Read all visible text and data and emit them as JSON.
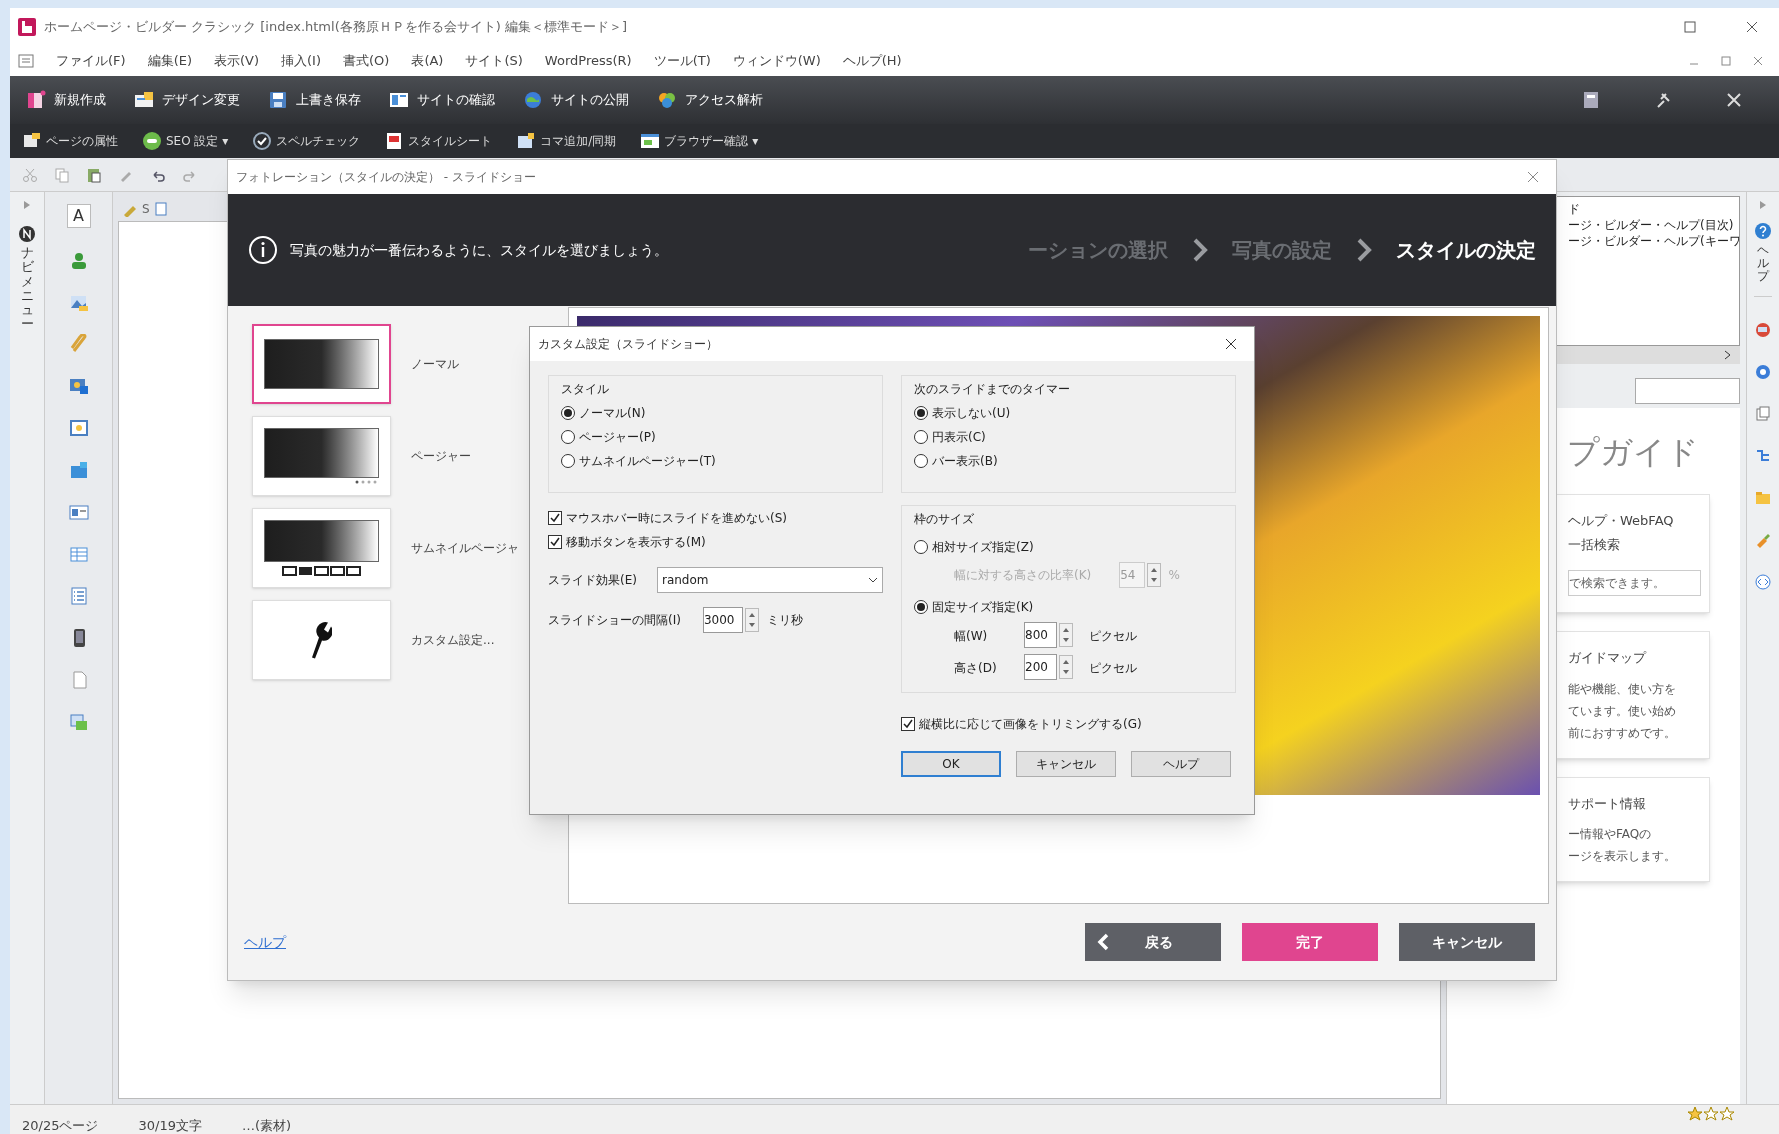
{
  "window": {
    "title": "ホームページ・ビルダー クラシック  [index.html(各務原ＨＰを作る会サイト)  編集＜標準モード＞]"
  },
  "menu": [
    "ファイル(F)",
    "編集(E)",
    "表示(V)",
    "挿入(I)",
    "書式(O)",
    "表(A)",
    "サイト(S)",
    "WordPress(R)",
    "ツール(T)",
    "ウィンドウ(W)",
    "ヘルプ(H)"
  ],
  "toolbar": [
    "新規作成",
    "デザイン変更",
    "上書き保存",
    "サイトの確認",
    "サイトの公開",
    "アクセス解析"
  ],
  "toolbar_2": [
    "ページの属性",
    "SEO 設定 ▾",
    "スペルチェック",
    "スタイルシート",
    "コマ追加/同期",
    "ブラウザー確認 ▾"
  ],
  "nav_tab": "ナビメニュー",
  "text_tool": "A",
  "editor_tab": "S",
  "help_tab": "ヘルプ",
  "right_panel": {
    "list_lines": [
      "ド",
      "ージ・ビルダー・ヘルプ(目次)",
      "ージ・ビルダー・ヘルプ(キーワ"
    ],
    "heading": "プガイド",
    "cards": [
      {
        "title_lines": [
          "ヘルプ・WebFAQ",
          "一括検索"
        ],
        "field": "で検索できます。"
      },
      {
        "title_lines": [
          "ガイドマップ"
        ],
        "lines": [
          "能や機能、使い方を",
          "ています。使い始め",
          "前におすすめです。"
        ]
      },
      {
        "title_lines": [
          "サポート情報"
        ],
        "lines": [
          "ー情報やFAQの",
          "ージを表示します。"
        ]
      }
    ]
  },
  "status_bar": [
    "20/25ページ",
    "30/19文字",
    "…(素材)"
  ],
  "wizard": {
    "title": "フォトレーション（スタイルの決定） - スライドショー",
    "message": "写真の魅力が一番伝わるように、スタイルを選びましょう。",
    "steps": [
      {
        "label": "ーションの選択",
        "selected": false
      },
      {
        "label": "写真の設定",
        "selected": false
      },
      {
        "label": "スタイルの決定",
        "selected": true
      }
    ],
    "styles": [
      {
        "label": "ノーマル",
        "kind": "normal",
        "selected": true
      },
      {
        "label": "ページャー",
        "kind": "pager",
        "selected": false
      },
      {
        "label": "サムネイルページャ",
        "kind": "thumbnail",
        "selected": false
      },
      {
        "label": "カスタム設定...",
        "kind": "custom",
        "selected": false
      }
    ],
    "help_link": "ヘルプ",
    "buttons": [
      {
        "label": "戻る",
        "kind": "back"
      },
      {
        "label": "完了",
        "kind": "primary"
      },
      {
        "label": "キャンセル",
        "kind": "cancel"
      }
    ]
  },
  "custom_dialog": {
    "title": "カスタム設定（スライドショー）",
    "style_group": {
      "label": "スタイル",
      "options": [
        {
          "label": "ノーマル(N)",
          "selected": true
        },
        {
          "label": "ページャー(P)",
          "selected": false
        },
        {
          "label": "サムネイルページャー(T)",
          "selected": false
        }
      ]
    },
    "timer_group": {
      "label": "次のスライドまでのタイマー",
      "options": [
        {
          "label": "表示しない(U)",
          "selected": true
        },
        {
          "label": "円表示(C)",
          "selected": false
        },
        {
          "label": "バー表示(B)",
          "selected": false
        }
      ]
    },
    "checkboxes": [
      {
        "label": "マウスホバー時にスライドを進めない(S)",
        "checked": true
      },
      {
        "label": "移動ボタンを表示する(M)",
        "checked": true
      }
    ],
    "effect": {
      "label": "スライド効果(E)",
      "value": "random"
    },
    "interval": {
      "label": "スライドショーの間隔(I)",
      "value": "3000",
      "unit": "ミリ秒"
    },
    "frame_group": {
      "label": "枠のサイズ",
      "relative": {
        "label": "相対サイズ指定(Z)",
        "selected": false
      },
      "ratio": {
        "label": "幅に対する高さの比率(K)",
        "value": "54",
        "unit": "%",
        "disabled": true
      },
      "fixed": {
        "label": "固定サイズ指定(K)",
        "selected": true
      },
      "width": {
        "label": "幅(W)",
        "value": "800",
        "unit": "ピクセル"
      },
      "height": {
        "label": "高さ(D)",
        "value": "200",
        "unit": "ピクセル"
      }
    },
    "trim": {
      "label": "縦横比に応じて画像をトリミングする(G)",
      "checked": true
    },
    "buttons": [
      {
        "label": "OK",
        "default": true
      },
      {
        "label": "キャンセル",
        "default": false
      },
      {
        "label": "ヘルプ",
        "default": false
      }
    ]
  }
}
